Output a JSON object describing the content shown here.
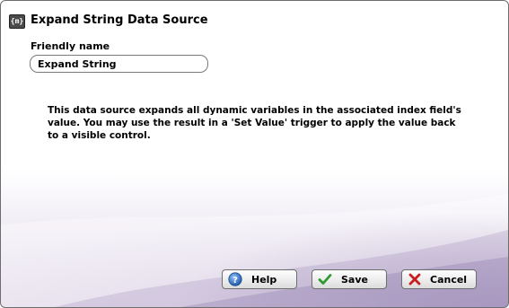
{
  "dialog": {
    "title": "Expand String Data Source",
    "title_icon": "data-source-icon",
    "title_icon_text": "{m}"
  },
  "form": {
    "friendly_name_label": "Friendly name",
    "friendly_name_value": "Expand String"
  },
  "description": "This data source expands all dynamic variables in the associated index field's value. You may use the result in a 'Set Value' trigger to apply the value back to a visible control.",
  "buttons": {
    "help": {
      "label": "Help",
      "icon": "help-icon"
    },
    "save": {
      "label": "Save",
      "icon": "checkmark-icon"
    },
    "cancel": {
      "label": "Cancel",
      "icon": "x-icon"
    }
  },
  "colors": {
    "accent_purple": "#866ea6",
    "help_blue": "#2a67b8",
    "save_green": "#2f9a2f",
    "cancel_red": "#c81e1e"
  }
}
